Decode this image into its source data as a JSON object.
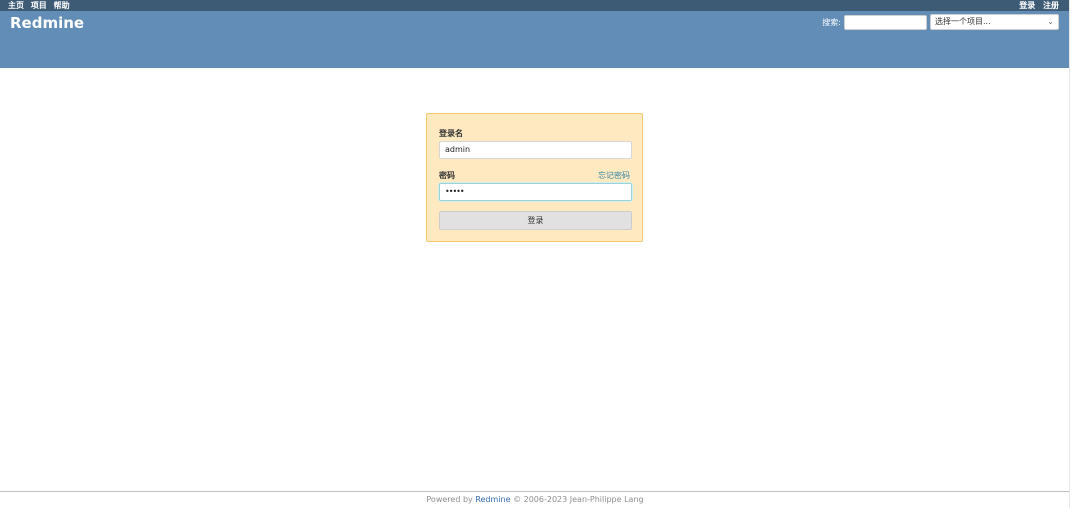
{
  "top_menu": {
    "home": "主页",
    "projects": "项目",
    "help": "帮助",
    "login": "登录",
    "register": "注册"
  },
  "header": {
    "logo": "Redmine",
    "search_label": "搜索:",
    "search_value": "",
    "project_select": "选择一个项目..."
  },
  "login_form": {
    "username_label": "登录名",
    "username_value": "admin",
    "password_label": "密码",
    "password_value": "•••••",
    "lost_password": "忘记密码",
    "submit_label": "登录"
  },
  "footer": {
    "prefix": "Powered by ",
    "link": "Redmine",
    "suffix": " © 2006-2023 Jean-Philippe Lang"
  },
  "colors": {
    "top_menu_bg": "#3e5b76",
    "header_bg": "#628db6",
    "login_box_bg": "#ffe9c1",
    "login_box_border": "#f3c96e",
    "link": "#2f86a6"
  },
  "icons": {
    "project_select": "chevron-down-icon"
  }
}
